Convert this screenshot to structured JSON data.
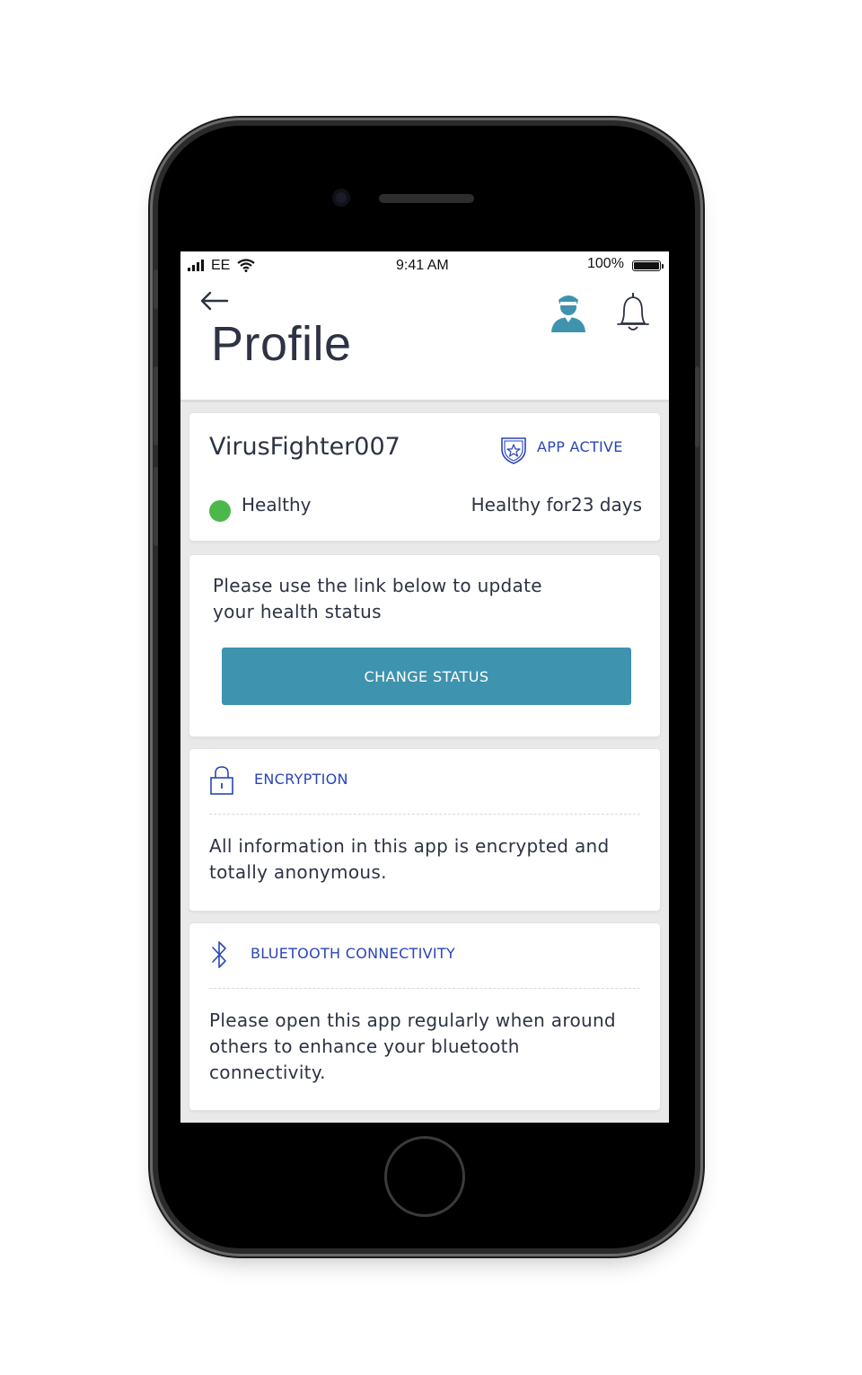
{
  "status_bar": {
    "carrier": "EE",
    "time": "9:41 AM",
    "battery": "100%"
  },
  "header": {
    "title": "Profile",
    "icons": [
      "back-arrow-icon",
      "user-icon",
      "bell-icon"
    ]
  },
  "profile": {
    "username": "VirusFighter007",
    "app_status": "APP ACTIVE",
    "health_status": "Healthy",
    "health_status_color": "#4cb84a",
    "healthy_for": "Healthy for23 days"
  },
  "update_card": {
    "instructions": "Please use the link below to update your health status",
    "button_label": "CHANGE STATUS",
    "button_color": "#3e93ae"
  },
  "encryption": {
    "title": "ENCRYPTION",
    "body": "All information in this app is encrypted and totally anonymous."
  },
  "bluetooth": {
    "title": "BLUETOOTH CONNECTIVITY",
    "body": "Please open this app regularly when around others to enhance your bluetooth connectivity."
  },
  "colors": {
    "accent_blue": "#2a45b7",
    "text_dark": "#2d3344"
  }
}
